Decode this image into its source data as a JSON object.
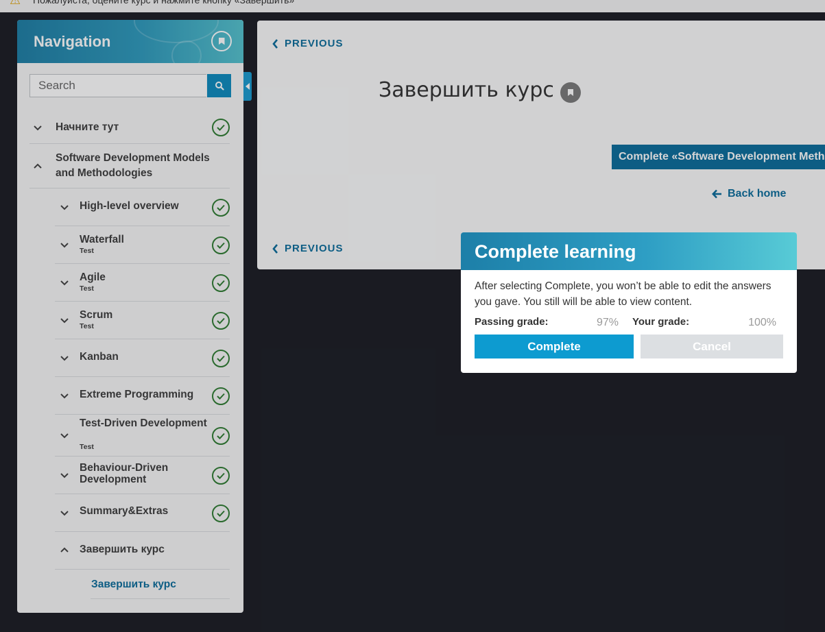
{
  "topbar": {
    "notice": "Пожалуйста, оцените курс и нажмите кнопку «Завершить»",
    "icon": "warning-icon"
  },
  "sidebar": {
    "title": "Navigation",
    "search": {
      "placeholder": "Search",
      "value": ""
    },
    "items": [
      {
        "label": "Начните тут",
        "sub": "",
        "expanded": false,
        "completed": true
      },
      {
        "label": "Software Development Models and Methodologies",
        "sub": "",
        "expanded": true,
        "completed": false
      },
      {
        "label": "High-level overview",
        "sub": "",
        "expanded": false,
        "completed": true
      },
      {
        "label": "Waterfall",
        "sub": "Test",
        "expanded": false,
        "completed": true
      },
      {
        "label": "Agile",
        "sub": "Test",
        "expanded": false,
        "completed": true
      },
      {
        "label": "Scrum",
        "sub": "Test",
        "expanded": false,
        "completed": true
      },
      {
        "label": "Kanban",
        "sub": "",
        "expanded": false,
        "completed": true
      },
      {
        "label": "Extreme Programming",
        "sub": "",
        "expanded": false,
        "completed": true
      },
      {
        "label": "Test-Driven Development",
        "sub": "Test",
        "expanded": false,
        "completed": true
      },
      {
        "label": "Behaviour-Driven Development",
        "sub": "",
        "expanded": false,
        "completed": true
      },
      {
        "label": "Summary&Extras",
        "sub": "",
        "expanded": false,
        "completed": true
      },
      {
        "label": "Завершить курс",
        "sub": "",
        "expanded": true,
        "completed": false
      },
      {
        "label": "Завершить курс",
        "sub": "",
        "expanded": false,
        "completed": false
      }
    ]
  },
  "content": {
    "previous_label": "PREVIOUS",
    "title": "Завершить курс",
    "complete_course_label": "Complete «Software Development Methodologies»",
    "back_home_label": "Back home"
  },
  "modal": {
    "title": "Complete learning",
    "text": "After selecting Complete, you won’t be able to edit the answers you gave. You still will be able to view content.",
    "passing_grade_label": "Passing grade:",
    "passing_grade_value": "97%",
    "your_grade_label": "Your grade:",
    "your_grade_value": "100%",
    "complete_label": "Complete",
    "cancel_label": "Cancel"
  },
  "colors": {
    "accent": "#0d9bd0",
    "link": "#0b6d9c",
    "check": "#2f7d32",
    "backdrop": "#1b1d24"
  }
}
